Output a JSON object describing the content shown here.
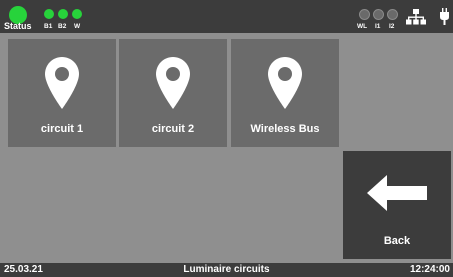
{
  "status_bar": {
    "status_label": "Status",
    "indicators": [
      {
        "label": "B1",
        "state": "on"
      },
      {
        "label": "B2",
        "state": "on"
      },
      {
        "label": "W",
        "state": "on"
      }
    ],
    "right_indicators": [
      {
        "label": "WL",
        "state": "off"
      },
      {
        "label": "I1",
        "state": "off"
      },
      {
        "label": "I2",
        "state": "off"
      }
    ],
    "icons": [
      "network-icon",
      "plug-icon"
    ],
    "colors": {
      "on": "#27d33b",
      "off": "#6a6a6a",
      "bar": "#3c3c3c"
    }
  },
  "tiles": [
    {
      "label": "circuit 1",
      "icon": "location-pin-icon"
    },
    {
      "label": "circuit 2",
      "icon": "location-pin-icon"
    },
    {
      "label": "Wireless Bus",
      "icon": "location-pin-icon"
    }
  ],
  "back": {
    "label": "Back",
    "icon": "arrow-left-icon"
  },
  "footer": {
    "date": "25.03.21",
    "title": "Luminaire circuits",
    "time": "12:24:00"
  }
}
